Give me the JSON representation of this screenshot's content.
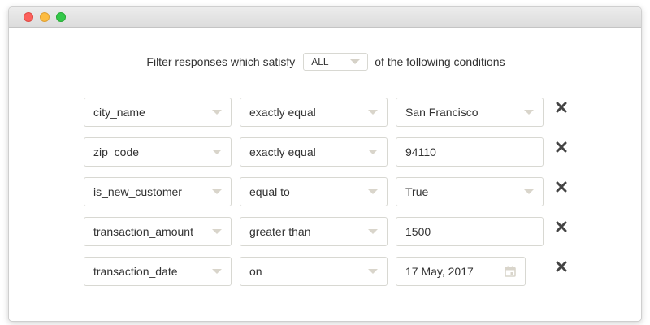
{
  "header": {
    "filter_prefix": "Filter responses which satisfy",
    "match_value": "ALL",
    "filter_suffix": "of the following conditions"
  },
  "conditions": [
    {
      "field": "city_name",
      "operator": "exactly equal",
      "value": "San Francisco",
      "value_type": "select"
    },
    {
      "field": "zip_code",
      "operator": "exactly equal",
      "value": "94110",
      "value_type": "text"
    },
    {
      "field": "is_new_customer",
      "operator": "equal to",
      "value": "True",
      "value_type": "select"
    },
    {
      "field": "transaction_amount",
      "operator": "greater than",
      "value": "1500",
      "value_type": "text"
    },
    {
      "field": "transaction_date",
      "operator": "on",
      "value": "17 May, 2017",
      "value_type": "date"
    }
  ],
  "icons": {
    "remove": "close-icon",
    "dropdown": "chevron-down-icon",
    "date": "calendar-icon"
  },
  "colors": {
    "border": "#d8d8d2",
    "caret": "#d9d5cb",
    "remove_icon": "#444444",
    "text": "#333333"
  }
}
